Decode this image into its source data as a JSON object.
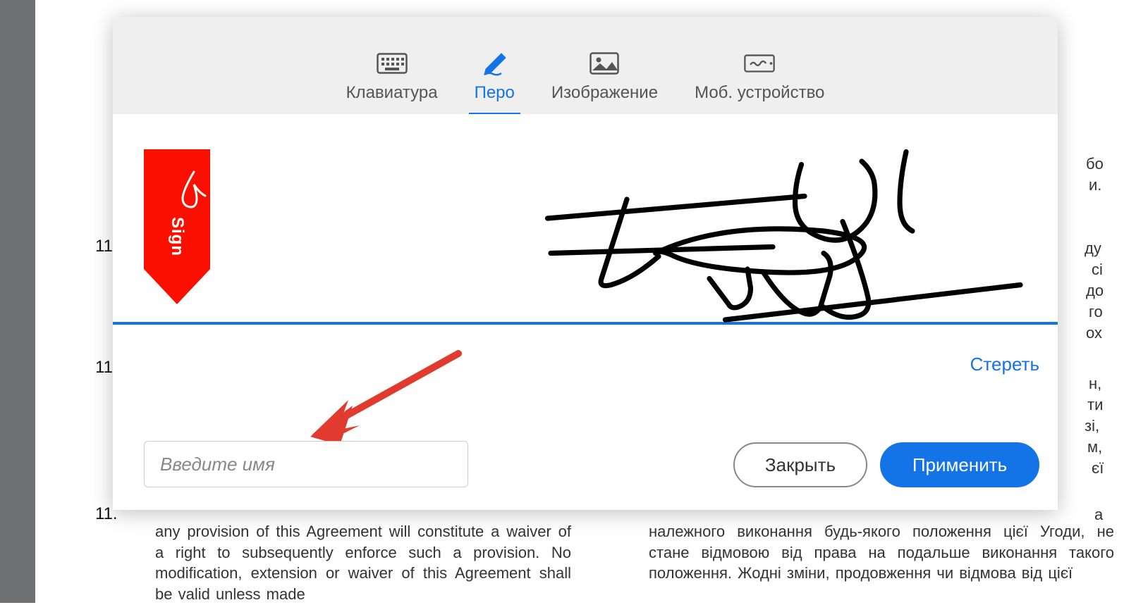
{
  "tabs": {
    "keyboard": "Клавиатура",
    "pen": "Перо",
    "image": "Изображение",
    "mobile": "Моб. устройство"
  },
  "sign_flag": {
    "text": "Sign"
  },
  "clear_label": "Стереть",
  "name_input_placeholder": "Введите имя",
  "buttons": {
    "close": "Закрыть",
    "apply": "Применить"
  },
  "bg": {
    "num_1": "11.",
    "num_2": "11.",
    "num_3": "11.",
    "left_para": "any provision of this Agreement will constitute a waiver of a right to subsequently enforce such a provision. No modification, extension or waiver of this Agreement shall be valid unless made",
    "right_frag_1": "бо",
    "right_frag_2": "и.",
    "right_frag_3": "ду",
    "right_frag_4": "сі",
    "right_frag_5": "до",
    "right_frag_6": "го",
    "right_frag_7": "ох",
    "right_frag_8": "н,",
    "right_frag_9": "ти",
    "right_frag_10": "зі,",
    "right_frag_11": "м,",
    "right_frag_12": "єї",
    "right_frag_13": "а",
    "right_para": "належного виконання будь-якого положення цієї Угоди, не стане відмовою від права на подальше виконання такого положення. Жодні зміни, продовження чи відмова від цієї"
  }
}
